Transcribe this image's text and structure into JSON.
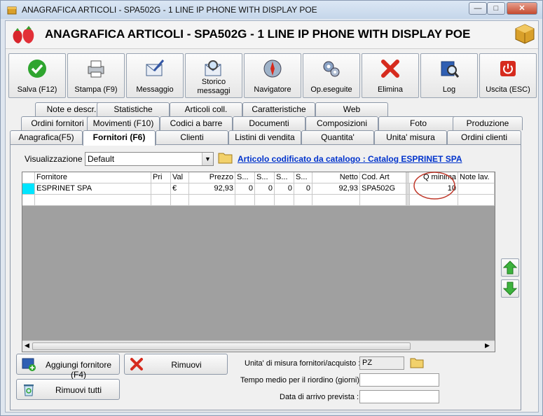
{
  "window": {
    "title": "ANAGRAFICA ARTICOLI - SPA502G - 1 LINE IP PHONE WITH DISPLAY  POE",
    "controls": [
      "minimize",
      "maximize",
      "close"
    ]
  },
  "header": {
    "title": "ANAGRAFICA ARTICOLI - SPA502G - 1 LINE IP PHONE WITH DISPLAY  POE"
  },
  "toolbar": {
    "buttons": [
      {
        "label": "Salva (F12)",
        "icon": "check-icon"
      },
      {
        "label": "Stampa (F9)",
        "icon": "printer-icon"
      },
      {
        "label": "Messaggio",
        "icon": "envelope-pen-icon"
      },
      {
        "label": "Storico messaggi",
        "icon": "envelope-search-icon"
      },
      {
        "label": "Navigatore",
        "icon": "compass-icon"
      },
      {
        "label": "Op.eseguite",
        "icon": "gears-icon"
      },
      {
        "label": "Elimina",
        "icon": "red-x-icon"
      },
      {
        "label": "Log",
        "icon": "book-search-icon"
      },
      {
        "label": "Uscita (ESC)",
        "icon": "power-icon"
      }
    ]
  },
  "tabs": {
    "row1": [
      "Note e descr.",
      "Statistiche",
      "Articoli coll.",
      "Caratteristiche",
      "Web"
    ],
    "row2": [
      "Ordini fornitori",
      "Movimenti (F10)",
      "Codici a barre",
      "Documenti",
      "Composizioni",
      "Foto",
      "Produzione"
    ],
    "row3": [
      "Anagrafica(F5)",
      "Fornitori (F6)",
      "Clienti",
      "Listini di vendita",
      "Quantita'",
      "Unita' misura",
      "Ordini clienti"
    ],
    "active": "Fornitori (F6)"
  },
  "panel": {
    "view_label": "Visualizzazione :",
    "view_value": "Default",
    "catalog_link": "Articolo codificato da catalogo : Catalog ESPRINET SPA",
    "table": {
      "columns": [
        "Fornitore",
        "Pri",
        "Val",
        "Prezzo",
        "S...",
        "S...",
        "S...",
        "S...",
        "Netto",
        "Cod. Art",
        "Q minima",
        "Note lav."
      ],
      "rows": [
        [
          "ESPRINET SPA",
          "",
          "€",
          "92,93",
          "0",
          "0",
          "0",
          "0",
          "92,93",
          "SPA502G",
          "10",
          ""
        ]
      ]
    },
    "add_supplier": "Aggiungi fornitore (F4)",
    "remove": "Rimuovi",
    "remove_all": "Rimuovi tutti",
    "uom_label": "Unita' di misura fornitori/acquisto :",
    "uom_value": "PZ",
    "lead_time_label": "Tempo medio per il riordino (giorni) :",
    "lead_time_value": "",
    "arrival_label": "Data di arrivo prevista :",
    "arrival_value": ""
  },
  "colors": {
    "accent_green": "#2fa52f",
    "accent_red": "#d62b1e",
    "link_blue": "#0033cc",
    "grid_bg": "#a0a0a0",
    "selection_cyan": "#00e5ff"
  }
}
